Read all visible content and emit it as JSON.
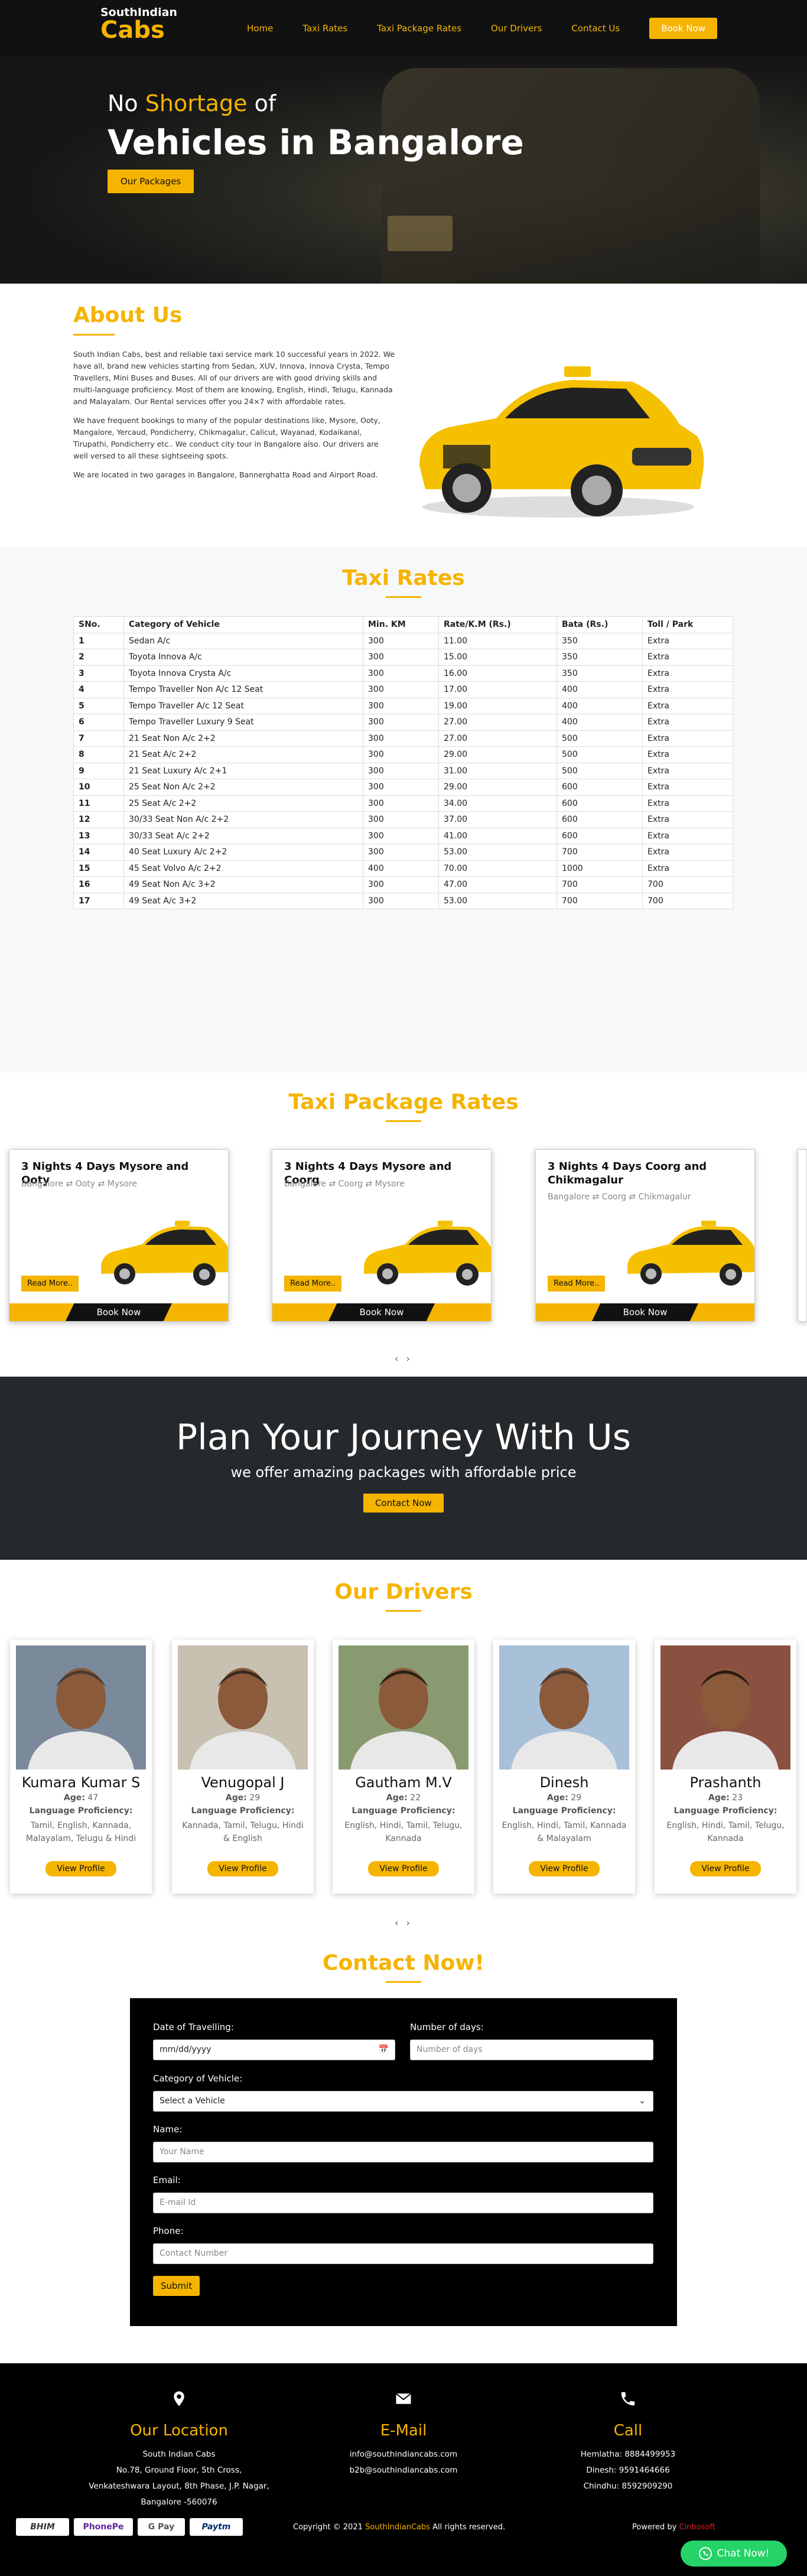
{
  "nav": {
    "brand_line1": "SouthIndian",
    "brand_line2": "Cabs",
    "items": [
      "Home",
      "Taxi Rates",
      "Taxi Package Rates",
      "Our Drivers",
      "Contact Us"
    ],
    "book_label": "Book Now"
  },
  "hero": {
    "sub_pre": "No ",
    "sub_highlight": "Shortage",
    "sub_post": " of",
    "title": "Vehicles in Bangalore",
    "button": "Our Packages"
  },
  "about": {
    "title": "About Us",
    "paragraphs": [
      "South Indian Cabs, best and reliable taxi service mark 10 successful years in 2022. We have all, brand new vehicles starting from Sedan, XUV, Innova, Innova Crysta, Tempo Travellers, Mini Buses and Buses. All of our drivers are with good driving skills and multi-language proficiency. Most of them are knowing, English, Hindi, Telugu, Kannada and Malayalam. Our Rental services offer you 24×7 with affordable rates.",
      "We have frequent bookings to many of the popular destinations like, Mysore, Ooty, Mangalore, Yercaud, Pondicherry, Chikmagalur, Calicut, Wayanad, Kodaikanal, Tirupathi, Pondicherry etc.. We conduct city tour in Bangalore also. Our drivers are well versed to all these sightseeing spots.",
      "We are located in two garages in Bangalore, Bannerghatta Road and Airport Road."
    ]
  },
  "rates": {
    "title": "Taxi Rates",
    "headers": [
      "SNo.",
      "Category of Vehicle",
      "Min. KM",
      "Rate/K.M (Rs.)",
      "Bata (Rs.)",
      "Toll / Park"
    ],
    "rows": [
      [
        "1",
        "Sedan A/c",
        "300",
        "11.00",
        "350",
        "Extra"
      ],
      [
        "2",
        "Toyota Innova A/c",
        "300",
        "15.00",
        "350",
        "Extra"
      ],
      [
        "3",
        "Toyota Innova Crysta A/c",
        "300",
        "16.00",
        "350",
        "Extra"
      ],
      [
        "4",
        "Tempo Traveller Non A/c 12 Seat",
        "300",
        "17.00",
        "400",
        "Extra"
      ],
      [
        "5",
        "Tempo Traveller A/c 12 Seat",
        "300",
        "19.00",
        "400",
        "Extra"
      ],
      [
        "6",
        "Tempo Traveller Luxury 9 Seat",
        "300",
        "27.00",
        "400",
        "Extra"
      ],
      [
        "7",
        "21 Seat Non A/c 2+2",
        "300",
        "27.00",
        "500",
        "Extra"
      ],
      [
        "8",
        "21 Seat A/c 2+2",
        "300",
        "29.00",
        "500",
        "Extra"
      ],
      [
        "9",
        "21 Seat Luxury A/c 2+1",
        "300",
        "31.00",
        "500",
        "Extra"
      ],
      [
        "10",
        "25 Seat Non A/c 2+2",
        "300",
        "29.00",
        "600",
        "Extra"
      ],
      [
        "11",
        "25 Seat A/c 2+2",
        "300",
        "34.00",
        "600",
        "Extra"
      ],
      [
        "12",
        "30/33 Seat Non A/c 2+2",
        "300",
        "37.00",
        "600",
        "Extra"
      ],
      [
        "13",
        "30/33 Seat A/c 2+2",
        "300",
        "41.00",
        "600",
        "Extra"
      ],
      [
        "14",
        "40 Seat Luxury A/c 2+2",
        "300",
        "53.00",
        "700",
        "Extra"
      ],
      [
        "15",
        "45 Seat Volvo A/c 2+2",
        "400",
        "70.00",
        "1000",
        "Extra"
      ],
      [
        "16",
        "49 Seat Non A/c 3+2",
        "300",
        "47.00",
        "700",
        "700"
      ],
      [
        "17",
        "49 Seat A/c 3+2",
        "300",
        "53.00",
        "700",
        "700"
      ]
    ]
  },
  "packages": {
    "title": "Taxi Package Rates",
    "items": [
      {
        "title": "3 Nights 4 Days Mysore and Ooty",
        "route": "Bangalore ⇄ Ooty ⇄ Mysore"
      },
      {
        "title": "3 Nights 4 Days Mysore and Coorg",
        "route": "Bangalore ⇄ Coorg ⇄ Mysore"
      },
      {
        "title": "3 Nights 4 Days Coorg and Chikmagalur",
        "route": "Bangalore ⇄ Coorg ⇄ Chikmagalur"
      }
    ],
    "read_more": "Read More..",
    "book_now": "Book Now",
    "dots": "‹ ›"
  },
  "plan": {
    "title": "Plan Your Journey With Us",
    "subtitle": "we offer amazing packages with affordable price",
    "button": "Contact Now"
  },
  "drivers": {
    "title": "Our Drivers",
    "age_label": "Age:",
    "lang_label": "Language Proficiency:",
    "button": "View Profile",
    "items": [
      {
        "name": "Kumara Kumar S",
        "age": "47",
        "langs": "Tamil, English, Kannada, Malayalam, Telugu & Hindi"
      },
      {
        "name": "Venugopal J",
        "age": "29",
        "langs": "Kannada, Tamil, Telugu, Hindi & English"
      },
      {
        "name": "Gautham M.V",
        "age": "22",
        "langs": "English, Hindi, Tamil, Telugu, Kannada"
      },
      {
        "name": "Dinesh",
        "age": "29",
        "langs": "English, Hindi, Tamil, Kannada & Malayalam"
      },
      {
        "name": "Prashanth",
        "age": "23",
        "langs": "English, Hindi, Tamil, Telugu, Kannada"
      }
    ],
    "dots": "‹ ›"
  },
  "contact": {
    "title": "Contact Now!",
    "date_label": "Date of Travelling:",
    "date_placeholder": "mm/dd/yyyy",
    "days_label": "Number of days:",
    "days_placeholder": "Number of days",
    "category_label": "Category of Vehicle:",
    "category_selected": "Select a Vehicle",
    "name_label": "Name:",
    "name_placeholder": "Your Name",
    "email_label": "Email:",
    "email_placeholder": "E-mail Id",
    "phone_label": "Phone:",
    "phone_placeholder": "Contact Number",
    "submit": "Submit"
  },
  "footer": {
    "location_title": "Our Location",
    "location_lines": [
      "South Indian Cabs",
      "No.78, Ground Floor, 5th Cross,",
      "Venkateshwara Layout, 8th Phase, J.P. Nagar,",
      "Bangalore -560076"
    ],
    "email_title": "E-Mail",
    "email_lines": [
      "info@southindiancabs.com",
      "b2b@southindiancabs.com"
    ],
    "call_title": "Call",
    "call_lines": [
      "Hemlatha: 8884499953",
      "Dinesh: 9591464666",
      "Chindhu: 8592909290"
    ],
    "payments": [
      "BHIM",
      "PhonePe",
      "G Pay",
      "Paytm"
    ],
    "copyright_pre": "Copyright © 2021 ",
    "copyright_brand": "SouthIndianCabs",
    "copyright_post": " All rights reserved.",
    "powered_pre": "Powered by ",
    "powered_brand": "Cinbosoft",
    "whatsapp": "Chat Now!"
  },
  "colors": {
    "accent": "#f5b400",
    "dark": "#111111",
    "plan_bg": "#26292c",
    "whatsapp": "#25d366"
  }
}
